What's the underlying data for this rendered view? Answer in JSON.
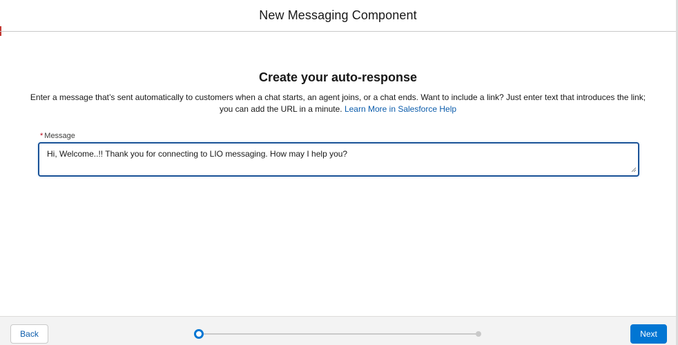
{
  "modal": {
    "title": "New Messaging Component"
  },
  "content": {
    "section_title": "Create your auto-response",
    "description": "Enter a message that’s sent automatically to customers when a chat starts, an agent joins, or a chat ends. Want to include a link? Just enter text that introduces the link; you can add the URL in a minute.",
    "help_link": "Learn More in Salesforce Help",
    "message_field": {
      "required_marker": "*",
      "label": "Message",
      "value": "Hi, Welcome..!! Thank you for connecting to LIO messaging. How may I help you?"
    }
  },
  "footer": {
    "back_label": "Back",
    "next_label": "Next",
    "progress": {
      "steps": 2,
      "current_step": 1
    }
  },
  "colors": {
    "brand": "#0176d3",
    "link": "#0b5cab",
    "required": "#ba0517",
    "textarea_border": "#1b5297"
  },
  "icons": {
    "resize_handle": "resize-grip-icon"
  }
}
